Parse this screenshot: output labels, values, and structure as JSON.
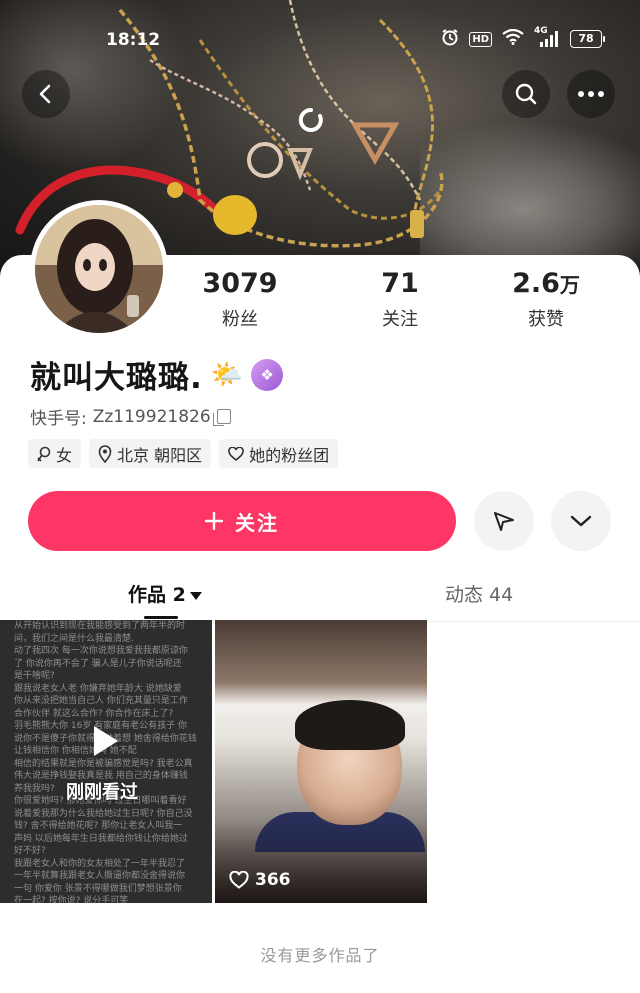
{
  "status_bar": {
    "time": "18:12",
    "hd_label": "HD",
    "network_label": "4G",
    "battery": "78"
  },
  "header": {
    "back_icon": "chevron-left-icon",
    "search_icon": "search-icon",
    "more_icon": "more-horizontal-icon"
  },
  "profile": {
    "followers_count": "3079",
    "followers_label": "粉丝",
    "following_count": "71",
    "following_label": "关注",
    "likes_count": "2.6",
    "likes_unit": "万",
    "likes_label": "获赞",
    "name": "就叫大璐璐.",
    "name_emoji": "🌤️",
    "kuaishou_id_label": "快手号:",
    "kuaishou_id": "Zz119921826",
    "tags": {
      "gender": "女",
      "location": "北京 朝阳区",
      "fan_club": "她的粉丝团"
    }
  },
  "actions": {
    "follow_label": "关注",
    "follow_color": "#fe3666"
  },
  "tabs": {
    "works_label": "作品 2",
    "moments_label": "动态 44"
  },
  "works": [
    {
      "overlay_text": "刚刚看过",
      "lines": [
        "从开始认识到现在我能感受到了两年半的时",
        "间，我们之间是什么我最清楚.",
        "动了我四次 每一次你说想我爱我我都原谅你",
        "了 你说你再不会了 骗人是儿子你说话呢还",
        "是干啥呢?",
        "跟我说老女人老 你嫌弃她年龄大 说她缺爱",
        "你从来没把她当自己人 你们充其量只是工作",
        "合作伙伴 就这么合作? 你合作在床上了?",
        "羽毛熊熊大你 16岁 有家庭有老公有孩子 你",
        "说你不是傻子你就得为她着想 她舍得给你花钱",
        "让钱相信你 你相信她吗 她不配",
        "相信的结果就是你是被骗感觉是吗? 我老公真",
        "伟大说是挣钱娶我真是我 用自己的身体赚钱",
        "养我我吗?",
        "你很爱她吗? 那她爱你吗 过生日哪叫着看好",
        "说着爱我那为什么我给她过生日呢? 你自己没",
        "钱? 舍不得给她花呢? 那你让老女人叫我一",
        "声妈 以后她每年生日我都给你钱让你给她过",
        "好不好?",
        "我跟老女人和你的女友相处了一年半我忍了",
        "一年半就算我跟老女人撕逼你都没舍得说你",
        "一句 你爱你 张景不得哪做我们梦想张景你",
        "在一起? 按你说? 说分手可笑"
      ]
    },
    {
      "likes": "366",
      "like_icon": "heart-icon"
    }
  ],
  "footer": {
    "no_more_text": "没有更多作品了"
  }
}
